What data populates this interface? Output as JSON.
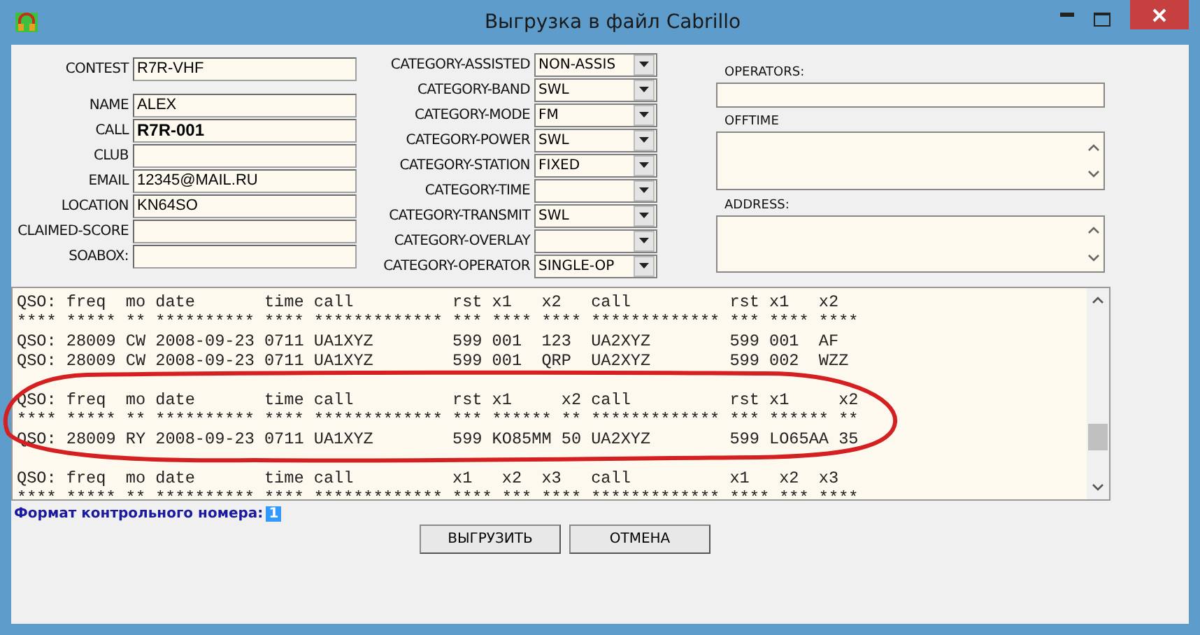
{
  "window": {
    "title": "Выгрузка в файл Cabrillo"
  },
  "fields": [
    {
      "label": "CONTEST",
      "value": "R7R-VHF",
      "bold": false
    },
    {
      "label": "NAME",
      "value": "ALEX",
      "bold": false
    },
    {
      "label": "CALL",
      "value": "R7R-001",
      "bold": true
    },
    {
      "label": "CLUB"
    },
    {
      "label": "EMAIL",
      "value": "12345@MAIL.RU",
      "bold": false
    },
    {
      "label": "LOCATION",
      "value": "KN64SO",
      "bold": false
    },
    {
      "label": "CLAIMED-SCORE"
    },
    {
      "label": "SOABOX:"
    }
  ],
  "categories": [
    {
      "label": "CATEGORY-ASSISTED",
      "value": "NON-ASSIS"
    },
    {
      "label": "CATEGORY-BAND",
      "value": "SWL"
    },
    {
      "label": "CATEGORY-MODE",
      "value": "FM"
    },
    {
      "label": "CATEGORY-POWER",
      "value": "SWL"
    },
    {
      "label": "CATEGORY-STATION",
      "value": "FIXED"
    },
    {
      "label": "CATEGORY-TIME"
    },
    {
      "label": "CATEGORY-TRANSMIT",
      "value": "SWL"
    },
    {
      "label": "CATEGORY-OVERLAY"
    },
    {
      "label": "CATEGORY-OPERATOR",
      "value": "SINGLE-OP"
    }
  ],
  "right_fields": [
    {
      "label": "OPERATORS:",
      "kind": "line"
    },
    {
      "label": "OFFTIME",
      "kind": "area"
    },
    {
      "label": "ADDRESS:",
      "kind": "area"
    }
  ],
  "log": {
    "blocks": [
      [
        "QSO: freq  mo date       time call          rst x1   x2   call          rst x1   x2",
        "**** ***** ** ********** **** ************* *** **** **** ************* *** **** ****",
        "QSO: 28009 CW 2008-09-23 0711 UA1XYZ        599 001  123  UA2XYZ        599 001  AF",
        "QSO: 28009 CW 2008-09-23 0711 UA1XYZ        599 001  QRP  UA2XYZ        599 002  WZZ"
      ],
      [
        "QSO: freq  mo date       time call          rst x1     x2 call          rst x1     x2",
        "**** ***** ** ********** **** ************* *** ****** ** ************* *** ****** **",
        "QSO: 28009 RY 2008-09-23 0711 UA1XYZ        599 KO85MM 50 UA2XYZ        599 LO65AA 35"
      ],
      [
        "QSO: freq  mo date       time call          x1   x2  x3   call          x1   x2  x3",
        "**** ***** ** ********** **** ************* **** *** **** ************* **** *** ****"
      ]
    ]
  },
  "format": {
    "label": "Формат контрольного номера:",
    "value": "1",
    "highlighted": true
  },
  "buttons": [
    "ВЫГРУЗИТЬ",
    "ОТМЕНА"
  ]
}
